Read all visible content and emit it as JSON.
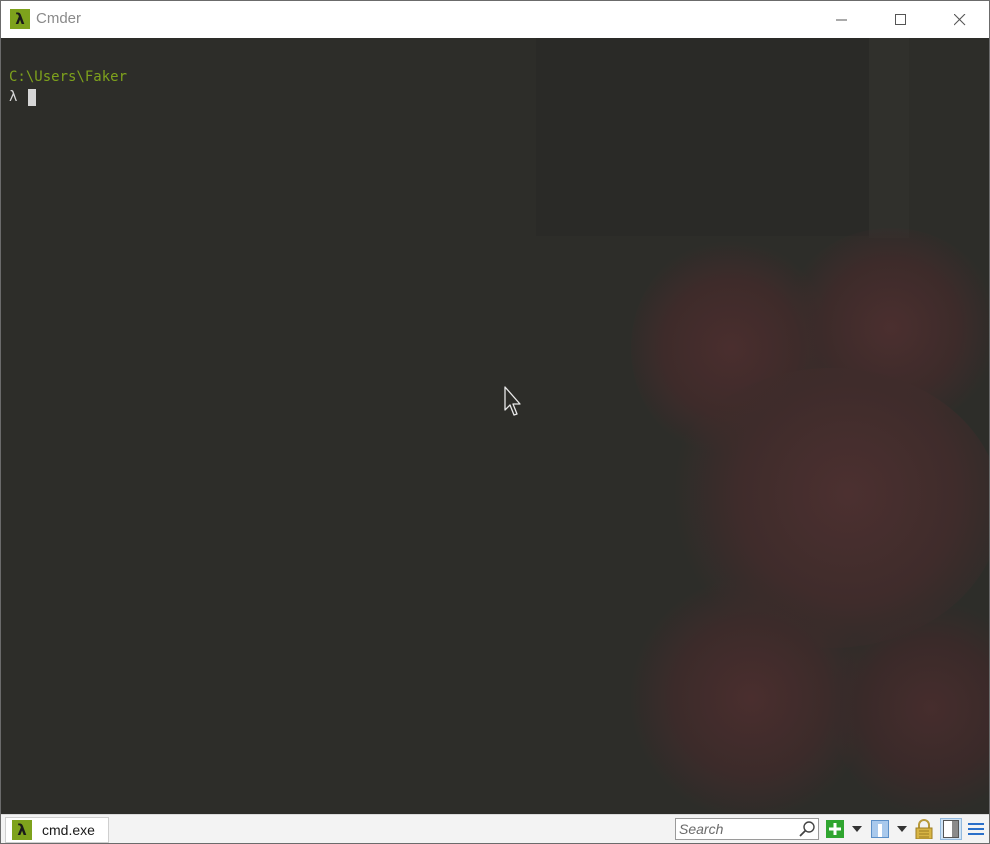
{
  "window": {
    "title": "Cmder",
    "app_icon_glyph": "λ",
    "controls": {
      "minimize": "minimize-icon",
      "maximize": "maximize-icon",
      "close": "close-icon"
    }
  },
  "terminal": {
    "path_line": "C:\\Users\\Faker",
    "prompt_symbol": "λ",
    "path_color": "#7ea21c",
    "background": "#2d2d29"
  },
  "statusbar": {
    "tab": {
      "icon_glyph": "λ",
      "label": "cmd.exe"
    },
    "search": {
      "placeholder": "Search",
      "value": ""
    },
    "buttons": [
      "add-console-icon",
      "add-dropdown-icon",
      "split-icon",
      "split-dropdown-icon",
      "lock-icon",
      "pane-toggle-icon",
      "menu-icon"
    ]
  },
  "colors": {
    "accent": "#7ea21c",
    "add_green": "#2fa52f"
  }
}
